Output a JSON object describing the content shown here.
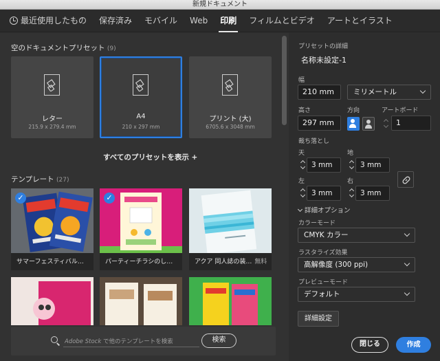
{
  "window": {
    "title": "新規ドキュメント"
  },
  "tabs": [
    {
      "label": "最近使用したもの",
      "active": false
    },
    {
      "label": "保存済み",
      "active": false
    },
    {
      "label": "モバイル",
      "active": false
    },
    {
      "label": "Web",
      "active": false
    },
    {
      "label": "印刷",
      "active": true
    },
    {
      "label": "フィルムとビデオ",
      "active": false
    },
    {
      "label": "アートとイラスト",
      "active": false
    }
  ],
  "blank_presets": {
    "heading": "空のドキュメントプリセット",
    "count": "(9)",
    "items": [
      {
        "name": "レター",
        "size": "215.9 x 279.4 mm",
        "selected": false
      },
      {
        "name": "A4",
        "size": "210 x 297 mm",
        "selected": true
      },
      {
        "name": "プリント (大)",
        "size": "6705.6 x 3048 mm",
        "selected": false
      }
    ],
    "show_all": "すべてのプリセットを表示 +"
  },
  "templates": {
    "heading": "テンプレート",
    "count": "(27)",
    "items": [
      {
        "name": "サマーフェスティバル…",
        "badge": ""
      },
      {
        "name": "パーティーチラシのし…",
        "badge": ""
      },
      {
        "name": "アクア 同人誌の装…",
        "badge": "無料"
      }
    ]
  },
  "search": {
    "stock": "Adobe Stock",
    "placeholder": " で他のテンプレートを検索",
    "button": "検索"
  },
  "details": {
    "heading": "プリセットの詳細",
    "doc_name": "名称未設定-1",
    "width_label": "幅",
    "width_value": "210 mm",
    "unit": "ミリメートル",
    "height_label": "高さ",
    "height_value": "297 mm",
    "orientation_label": "方向",
    "artboard_label": "アートボード",
    "artboard_value": "1",
    "bleed_label": "裁ち落とし",
    "bleed": {
      "top_label": "天",
      "top": "3 mm",
      "bottom_label": "地",
      "bottom": "3 mm",
      "left_label": "左",
      "left": "3 mm",
      "right_label": "右",
      "right": "3 mm"
    },
    "advanced_label": "詳細オプション",
    "color_mode_label": "カラーモード",
    "color_mode": "CMYK カラー",
    "raster_label": "ラスタライズ効果",
    "raster": "高解像度 (300 ppi)",
    "preview_label": "プレビューモード",
    "preview": "デフォルト",
    "more_settings": "詳細設定",
    "close": "閉じる",
    "create": "作成"
  },
  "colors": {
    "accent": "#2f7fe0",
    "panel": "#323232",
    "sidebar": "#2d2d2d"
  }
}
